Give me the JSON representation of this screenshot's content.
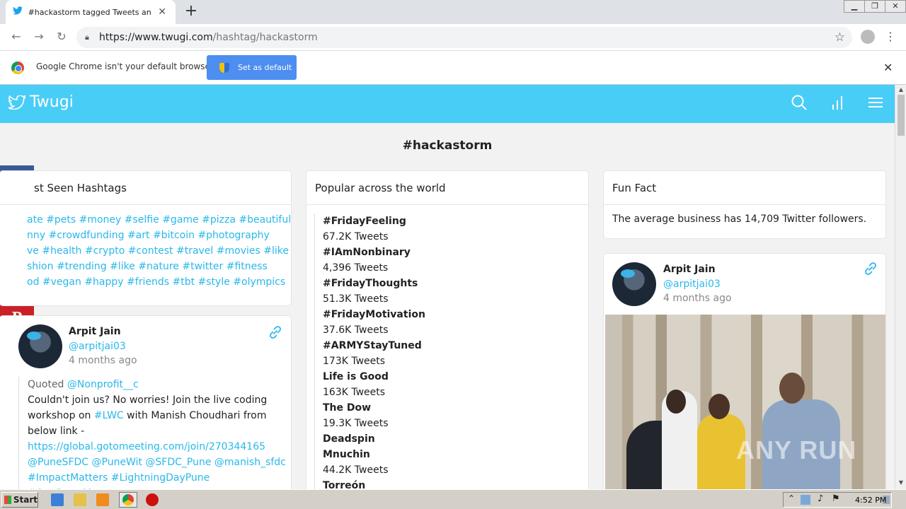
{
  "browser": {
    "tab_title": "#hackastorm tagged Tweets and Do",
    "url_host": "https://www.twugi.com",
    "url_path": "/hashtag/hackastorm",
    "infobar_text": "Google Chrome isn't your default browser",
    "set_default_label": "Set as default"
  },
  "site": {
    "brand": "Twugi",
    "page_title": "#hackastorm",
    "accent_color": "#48cdf7"
  },
  "share": {
    "items": [
      "facebook-icon",
      "twitter-icon",
      "print-icon",
      "email-icon",
      "pinterest-icon",
      "more-icon"
    ],
    "colors": [
      "#3b5998",
      "#1da1f2",
      "#7f7f7f",
      "#666666",
      "#cb2027",
      "#ff6550"
    ]
  },
  "recent_hashtags": {
    "title": "st Seen Hashtags",
    "lines": [
      [
        "ate",
        "#pets",
        "#money",
        "#selfie",
        "#game",
        "#pizza",
        "#beautiful"
      ],
      [
        "nny",
        "#crowdfunding",
        "#art",
        "#bitcoin",
        "#photography"
      ],
      [
        "ve",
        "#health",
        "#crypto",
        "#contest",
        "#travel",
        "#movies",
        "#like"
      ],
      [
        "shion",
        "#trending",
        "#like",
        "#nature",
        "#twitter",
        "#fitness"
      ],
      [
        "od",
        "#vegan",
        "#happy",
        "#friends",
        "#tbt",
        "#style",
        "#olympics"
      ]
    ]
  },
  "popular": {
    "title": "Popular across the world",
    "trends": [
      {
        "name": "#FridayFeeling",
        "count": "67.2K Tweets"
      },
      {
        "name": "#IAmNonbinary",
        "count": "4,396 Tweets"
      },
      {
        "name": "#FridayThoughts",
        "count": "51.3K Tweets"
      },
      {
        "name": "#FridayMotivation",
        "count": "37.6K Tweets"
      },
      {
        "name": "#ARMYStayTuned",
        "count": "173K Tweets"
      },
      {
        "name": "Life is Good",
        "count": "163K Tweets"
      },
      {
        "name": "The Dow",
        "count": "19.3K Tweets"
      },
      {
        "name": "Deadspin",
        "count": ""
      },
      {
        "name": "Mnuchin",
        "count": "44.2K Tweets"
      },
      {
        "name": "Torreón",
        "count": ""
      }
    ]
  },
  "fun_fact": {
    "title": "Fun Fact",
    "text": "The average business has 14,709 Twitter followers."
  },
  "tweet_left": {
    "name": "Arpit Jain",
    "handle": "@arpitjai03",
    "ago": "4 months ago",
    "quoted_label": "Quoted",
    "quoted_handle": "@Nonprofit__c",
    "text1": "Couldn't join us? No worries! Join the live coding",
    "text2_pre": "workshop on ",
    "text2_tag": "#LWC",
    "text2_post": " with Manish Choudhari from",
    "text3": "below link -",
    "link": "https://global.gotomeeting.com/join/270344165",
    "mentions": "@PuneSFDC @PuneWit @SFDC_Pune @manish_sfdc",
    "tags": "#ImpactMatters #LightningDayPune #OnePuneOhana"
  },
  "tweet_right": {
    "name": "Arpit Jain",
    "handle": "@arpitjai03",
    "ago": "4 months ago",
    "watermark": "ANY RUN"
  },
  "taskbar": {
    "start_label": "Start",
    "clock": "4:52 PM"
  }
}
